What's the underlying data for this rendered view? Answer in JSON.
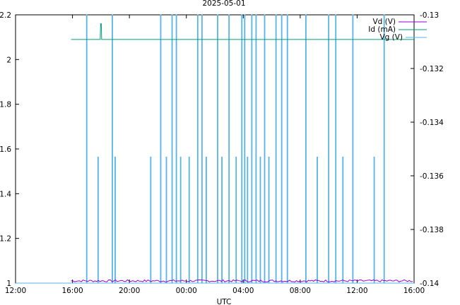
{
  "chart_data": {
    "type": "line",
    "title": "2025-05-01",
    "xlabel": "UTC",
    "ylabel": "",
    "y2label": "",
    "x_ticks": [
      "12:00",
      "16:00",
      "20:00",
      "00:00",
      "04:00",
      "08:00",
      "12:00",
      "16:00"
    ],
    "x_range_hours": [
      0,
      28
    ],
    "ylim": [
      1,
      2.2
    ],
    "y_ticks": [
      "1",
      "1.2",
      "1.4",
      "1.6",
      "1.8",
      "2",
      "2.2"
    ],
    "y2lim": [
      -0.14,
      -0.13
    ],
    "y2_ticks": [
      "-0.14",
      "-0.138",
      "-0.136",
      "-0.134",
      "-0.132",
      "-0.13"
    ],
    "legend_position": "top-right",
    "series": [
      {
        "name": "Vd (V)",
        "axis": "left",
        "color": "#9400d3",
        "x_start_hours": 3.9,
        "x_end_hours": 28,
        "baseline": 1.01,
        "noise_amplitude": 0.005
      },
      {
        "name": "Id (mA)",
        "axis": "left",
        "color": "#009e73",
        "x_start_hours": 3.9,
        "x_end_hours": 28,
        "baseline": 2.09,
        "blip": {
          "x_hours": 6.0,
          "peak": 2.16
        }
      },
      {
        "name": "Vg (V)",
        "axis": "right",
        "color": "#56b4e9",
        "baseline": -0.14,
        "spikes": [
          {
            "x_hours": 5.0,
            "peak": -0.13
          },
          {
            "x_hours": 5.8,
            "peak": -0.1353
          },
          {
            "x_hours": 6.8,
            "peak": -0.13
          },
          {
            "x_hours": 7.0,
            "peak": -0.1353
          },
          {
            "x_hours": 9.5,
            "peak": -0.1353
          },
          {
            "x_hours": 10.2,
            "peak": -0.13
          },
          {
            "x_hours": 10.6,
            "peak": -0.1353
          },
          {
            "x_hours": 11.0,
            "peak": -0.13
          },
          {
            "x_hours": 11.3,
            "peak": -0.13
          },
          {
            "x_hours": 11.6,
            "peak": -0.1353
          },
          {
            "x_hours": 12.2,
            "peak": -0.1353
          },
          {
            "x_hours": 12.8,
            "peak": -0.13
          },
          {
            "x_hours": 13.1,
            "peak": -0.13
          },
          {
            "x_hours": 13.4,
            "peak": -0.1353
          },
          {
            "x_hours": 14.2,
            "peak": -0.13
          },
          {
            "x_hours": 14.5,
            "peak": -0.1353
          },
          {
            "x_hours": 15.0,
            "peak": -0.13
          },
          {
            "x_hours": 15.5,
            "peak": -0.1353
          },
          {
            "x_hours": 15.9,
            "peak": -0.13
          },
          {
            "x_hours": 16.1,
            "peak": -0.13
          },
          {
            "x_hours": 16.3,
            "peak": -0.1353
          },
          {
            "x_hours": 16.6,
            "peak": -0.13
          },
          {
            "x_hours": 16.9,
            "peak": -0.13
          },
          {
            "x_hours": 17.2,
            "peak": -0.1353
          },
          {
            "x_hours": 17.5,
            "peak": -0.13
          },
          {
            "x_hours": 17.8,
            "peak": -0.1353
          },
          {
            "x_hours": 18.3,
            "peak": -0.13
          },
          {
            "x_hours": 18.7,
            "peak": -0.13
          },
          {
            "x_hours": 19.1,
            "peak": -0.13
          },
          {
            "x_hours": 20.4,
            "peak": -0.13
          },
          {
            "x_hours": 21.2,
            "peak": -0.1353
          },
          {
            "x_hours": 22.0,
            "peak": -0.13
          },
          {
            "x_hours": 22.5,
            "peak": -0.13
          },
          {
            "x_hours": 23.0,
            "peak": -0.1353
          },
          {
            "x_hours": 23.7,
            "peak": -0.13
          },
          {
            "x_hours": 25.2,
            "peak": -0.1353
          },
          {
            "x_hours": 25.9,
            "peak": -0.13
          }
        ]
      }
    ]
  }
}
